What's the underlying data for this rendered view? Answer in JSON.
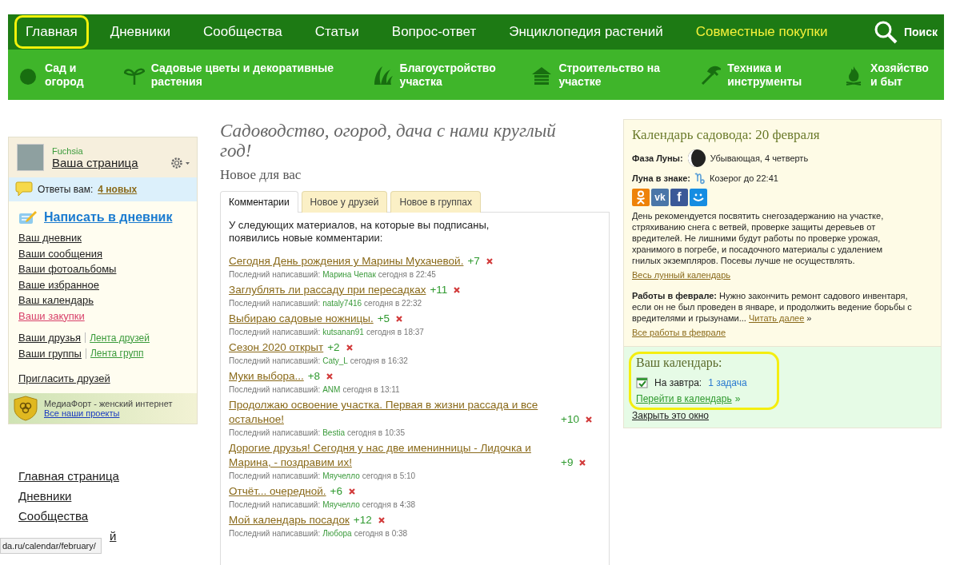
{
  "top_nav": [
    {
      "label": "Главная",
      "kind": "main",
      "selected": true
    },
    {
      "label": "Дневники",
      "kind": "main",
      "selected": false
    },
    {
      "label": "Сообщества",
      "kind": "main",
      "selected": false
    },
    {
      "label": "Статьи",
      "kind": "main",
      "selected": false
    },
    {
      "label": "Вопрос-ответ",
      "kind": "main",
      "selected": false
    },
    {
      "label": "Энциклопедия растений",
      "kind": "main",
      "selected": false
    },
    {
      "label": "Совместные покупки",
      "kind": "promo",
      "selected": false
    }
  ],
  "search_button": "Поиск",
  "categories": [
    {
      "label": "Сад и огород"
    },
    {
      "label": "Садовые цветы и декоративные растения"
    },
    {
      "label": "Благоустройство участка"
    },
    {
      "label": "Строительство на участке"
    },
    {
      "label": "Техника и инструменты"
    },
    {
      "label": "Хозяйство и быт"
    }
  ],
  "sidebar": {
    "user_name": "Fuchsia",
    "page_link": "Ваша страница",
    "answers": {
      "label": "Ответы вам:",
      "link": "4 новых"
    },
    "write_link": "Написать в дневник",
    "links": [
      {
        "label": "Ваш дневник",
        "kind": "normal"
      },
      {
        "label": "Ваши сообщения",
        "kind": "normal"
      },
      {
        "label": "Ваши фотоальбомы",
        "kind": "normal"
      },
      {
        "label": "Ваше избранное",
        "kind": "normal"
      },
      {
        "label": "Ваш календарь",
        "kind": "normal"
      },
      {
        "label": "Ваши закупки",
        "kind": "promo"
      }
    ],
    "pairs": [
      {
        "main": "Ваши друзья",
        "feed": "Лента друзей"
      },
      {
        "main": "Ваши группы",
        "feed": "Лента групп"
      }
    ],
    "invite": "Пригласить друзей",
    "promo": {
      "text": "МедиаФорт - женский интернет",
      "link": "Все наши проекты"
    }
  },
  "bottom_links": [
    "Главная страница",
    "Дневники",
    "Сообщества",
    "й"
  ],
  "status_url": "da.ru/calendar/february/",
  "slogan": "Садоводство, огород, дача с нами круглый год!",
  "section_title": "Новое для вас",
  "tabs": [
    {
      "label": "Комментарии",
      "selected": true
    },
    {
      "label": "Новое у друзей",
      "selected": false
    },
    {
      "label": "Новое в группах",
      "selected": false
    }
  ],
  "intro": "У следующих материалов, на которые вы подписаны, появились новые комментарии:",
  "comments": [
    {
      "title": "Сегодня День рождения у Марины Мухачевой.",
      "count": "+7",
      "meta_label": "Последний написавший:",
      "author": "Марина Чепак",
      "time": "сегодня в 22:45"
    },
    {
      "title": "Заглублять ли рассаду при пересадках",
      "count": "+11",
      "meta_label": "Последний написавший:",
      "author": "nataly7416",
      "time": "сегодня в 22:32"
    },
    {
      "title": "Выбираю садовые ножницы.",
      "count": "+5",
      "meta_label": "Последний написавший:",
      "author": "kutsanan91",
      "time": "сегодня в 18:37"
    },
    {
      "title": "Сезон 2020 открыт",
      "count": "+2",
      "meta_label": "Последний написавший:",
      "author": "Caty_L",
      "time": "сегодня в 16:32"
    },
    {
      "title": "Муки выбора...",
      "count": "+8",
      "meta_label": "Последний написавший:",
      "author": "ANM",
      "time": "сегодня в 13:11"
    },
    {
      "title": "Продолжаю освоение участка. Первая в жизни рассада и все остальное!",
      "count": "+10",
      "meta_label": "Последний написавший:",
      "author": "Bestia",
      "time": "сегодня в 10:35"
    },
    {
      "title": "Дорогие друзья! Сегодня у нас две именинницы - Лидочка и Марина, - поздравим их!",
      "count": "+9",
      "meta_label": "Последний написавший:",
      "author": "Мяучелло",
      "time": "сегодня в 5:10"
    },
    {
      "title": "Отчёт... очередной.",
      "count": "+6",
      "meta_label": "Последний написавший:",
      "author": "Мяучелло",
      "time": "сегодня в 4:38"
    },
    {
      "title": "Мой календарь посадок",
      "count": "+12",
      "meta_label": "Последний написавший:",
      "author": "Любора",
      "time": "сегодня в 0:38"
    }
  ],
  "calendar": {
    "title": "Календарь садовода: 20 февраля",
    "moon_phase": {
      "label": "Фаза Луны:",
      "value": "Убывающая, 4 четверть"
    },
    "moon_sign": {
      "label": "Луна в знаке:",
      "value": "Козерог до 22:41"
    },
    "social": [
      {
        "kind": "ok",
        "color": "#ee8208"
      },
      {
        "kind": "vk",
        "color": "#4a76a8",
        "glyph": "vk"
      },
      {
        "kind": "fb",
        "color": "#3b5998",
        "glyph": "f"
      },
      {
        "kind": "mail",
        "color": "#168de2"
      }
    ],
    "advice": "День рекомендуется посвятить снегозадержанию на участке, стряхиванию снега с ветвей, проверке защиты деревьев от вредителей. Не лишними будут работы по проверке урожая, хранимого в погребе, и посадочного материалы с удалением гнилых экземпляров. Посевы лучше не осуществлять.",
    "moon_link": "Весь лунный календарь",
    "works_label": "Работы в феврале:",
    "works_text": "Нужно закончить ремонт садового инвентаря, если он не был проведен в январе, и продолжить ведение борьбы с вредителями и грызунами...",
    "read_more": "Читать далее",
    "read_more_arrow": "»",
    "all_works_link": "Все работы в феврале"
  },
  "your_calendar": {
    "title": "Ваш календарь:",
    "highlighted": true,
    "tomorrow_label": "На завтра:",
    "tomorrow_link": "1 задача",
    "go_link": "Перейти в календарь",
    "go_arrow": "»",
    "close_link": "Закрыть это окно"
  }
}
